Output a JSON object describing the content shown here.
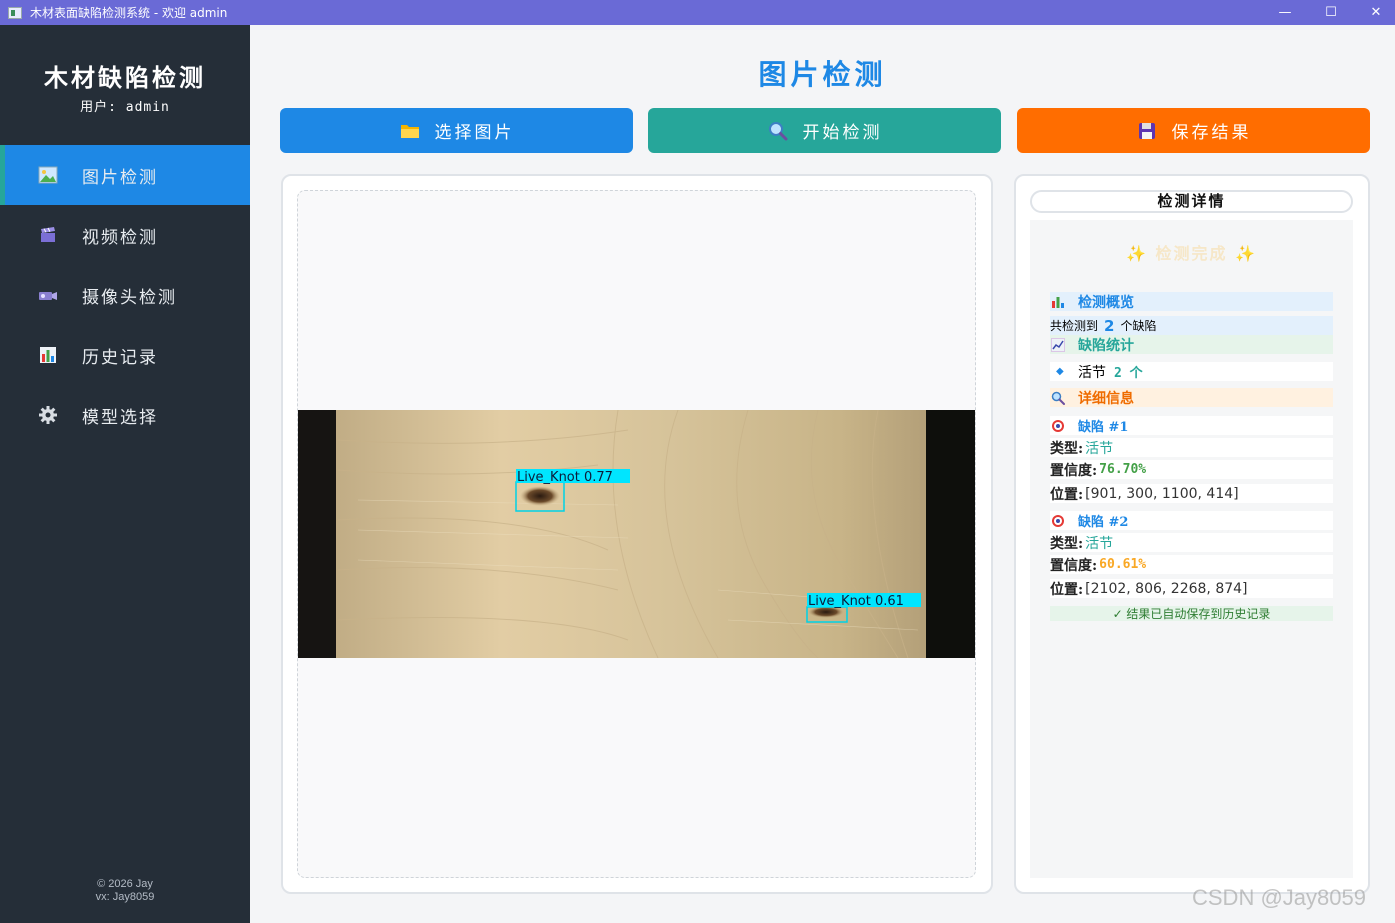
{
  "window": {
    "title": "木材表面缺陷检测系统 - 欢迎 admin",
    "minimize": "—",
    "maximize": "☐",
    "close": "✕"
  },
  "sidebar": {
    "app_title": "木材缺陷检测",
    "user_line": "用户: admin",
    "items": [
      {
        "label": "图片检测",
        "icon": "image-icon",
        "active": true
      },
      {
        "label": "视频检测",
        "icon": "clapper-icon",
        "active": false
      },
      {
        "label": "摄像头检测",
        "icon": "camera-icon",
        "active": false
      },
      {
        "label": "历史记录",
        "icon": "bar-chart-icon",
        "active": false
      },
      {
        "label": "模型选择",
        "icon": "gear-icon",
        "active": false
      }
    ],
    "footer_line1": "© 2026 Jay",
    "footer_line2": "vx: Jay8059"
  },
  "main": {
    "title": "图片检测",
    "buttons": {
      "select": "选择图片",
      "start": "开始检测",
      "save": "保存结果"
    },
    "detections": [
      {
        "label": "Live_Knot 0.77"
      },
      {
        "label": "Live_Knot 0.61"
      }
    ]
  },
  "details": {
    "header": "检测详情",
    "done_title": "✨ 检测完成 ✨",
    "overview_title": "检测概览",
    "overview_prefix": "共检测到",
    "overview_count": "2",
    "overview_suffix": "个缺陷",
    "stats_title": "缺陷统计",
    "stats_item_name": "活节",
    "stats_item_count": "2 个",
    "info_title": "详细信息",
    "defects": [
      {
        "title": "缺陷 #1",
        "type_label": "类型:",
        "type": "活节",
        "conf_label": "置信度:",
        "conf": "76.70%",
        "pos_label": "位置:",
        "pos": "[901, 300, 1100, 414]"
      },
      {
        "title": "缺陷 #2",
        "type_label": "类型:",
        "type": "活节",
        "conf_label": "置信度:",
        "conf": "60.61%",
        "pos_label": "位置:",
        "pos": "[2102, 806, 2268, 874]"
      }
    ],
    "saved_note": "✓ 结果已自动保存到历史记录"
  },
  "watermark": "CSDN @Jay8059",
  "colors": {
    "accent_blue": "#1e88e5",
    "teal": "#26a69a",
    "orange": "#ff6d00",
    "sidebar_bg": "#252e38",
    "titlebar_bg": "#6a6ad6"
  }
}
